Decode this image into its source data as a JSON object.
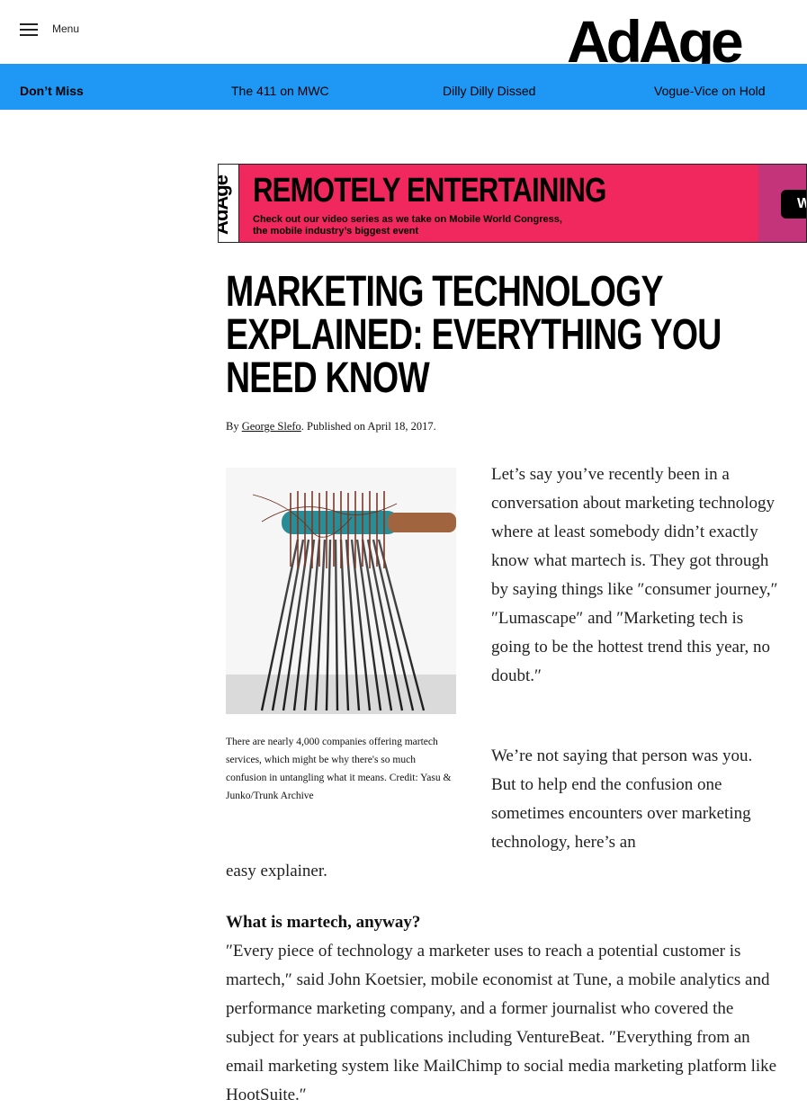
{
  "header": {
    "menu_label": "Menu",
    "logo_text": "AdAge"
  },
  "nav": {
    "dont_miss": "Don’t Miss",
    "links": [
      "The 411 on MWC",
      "Dilly Dilly Dissed",
      "Vogue-Vice on Hold"
    ]
  },
  "banner": {
    "logo_text": "AdAge",
    "headline": "REMOTELY ENTERTAINING",
    "sub_line1": "Check out our video series as we take on Mobile World Congress,",
    "sub_line2": "the mobile industry’s biggest event",
    "button_label": "W"
  },
  "article": {
    "headline": "MARKETING TECHNOLOGY EXPLAINED: EVERYTHING YOU NEED KNOW",
    "byline_prefix": "By ",
    "author": "George Slefo",
    "published": ". Published on April 18, 2017.",
    "caption": "There are nearly 4,000 companies offering martech services, which might be why there's so much confusion in untangling what it means. Credit: Yasu & Junko/Trunk Archive",
    "p1": "Let’s say you’ve recently been in a conversation about marketing technology where at least somebody didn’t exactly know what martech is. They got through by saying things like ″consumer journey,″ ″Lumascape″ and ″Marketing tech is going to be the hottest trend this year, no doubt.″",
    "p2": "We’re not saying that person was you. But to help end the confusion one sometimes encounters over marketing technology, here’s an",
    "p2_end": "easy explainer.",
    "subhead": "What is martech, anyway?",
    "p3": "″Every piece of technology a marketer uses to reach a potential customer is martech,″ said John Koetsier, mobile economist at Tune, a mobile analytics and performance marketing company, and a former journalist who covered the subject for years at publications including VentureBeat. ″Everything from an email marketing system like MailChimp to social media marketing platform like HootSuite.″"
  }
}
